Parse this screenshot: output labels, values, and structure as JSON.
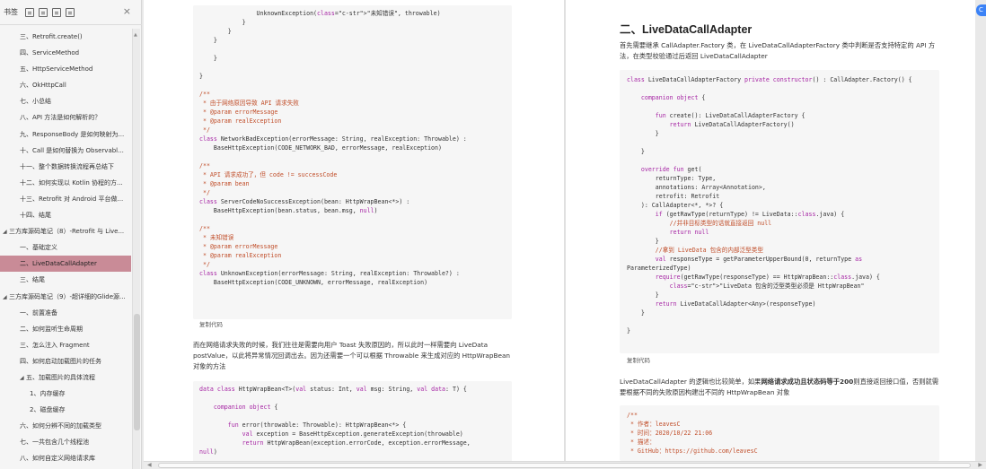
{
  "sidebar": {
    "title": "书签",
    "toolbar_icons": [
      "expand-icon",
      "collapse-icon",
      "bookmark-add-icon",
      "bookmark-icon"
    ],
    "close_label": "×",
    "items": [
      {
        "label": "三、Retrofit.create()",
        "level": 1
      },
      {
        "label": "四、ServiceMethod",
        "level": 1
      },
      {
        "label": "五、HttpServiceMethod",
        "level": 1
      },
      {
        "label": "六、OkHttpCall",
        "level": 1
      },
      {
        "label": "七、小总结",
        "level": 1
      },
      {
        "label": "八、API 方法是如何解析的？",
        "level": 1
      },
      {
        "label": "九、ResponseBody 是如何映射为...",
        "level": 1
      },
      {
        "label": "十、Call 是如何替换为 Observabl...",
        "level": 1
      },
      {
        "label": "十一、整个数据转换流程再总结下",
        "level": 1
      },
      {
        "label": "十二、如何实现以 Kotlin 协程的方...",
        "level": 1
      },
      {
        "label": "十三、Retrofit 对 Android 平台做...",
        "level": 1
      },
      {
        "label": "十四、结尾",
        "level": 1
      },
      {
        "label": "三方库源码笔记（8）-Retrofit 与 Live...",
        "level": 0
      },
      {
        "label": "一、基础定义",
        "level": 1
      },
      {
        "label": "二、LiveDataCallAdapter",
        "level": 1,
        "active": true
      },
      {
        "label": "三、结尾",
        "level": 1
      },
      {
        "label": "三方库源码笔记（9）-超详细的Glide源...",
        "level": 0
      },
      {
        "label": "一、前置准备",
        "level": 1
      },
      {
        "label": "二、如何监听生命周期",
        "level": 1
      },
      {
        "label": "三、怎么注入 Fragment",
        "level": 1
      },
      {
        "label": "四、如何启动加载图片的任务",
        "level": 1
      },
      {
        "label": "五、加载图片的具体流程",
        "level": 1,
        "expanded": true
      },
      {
        "label": "1、内存缓存",
        "level": 2
      },
      {
        "label": "2、磁盘缓存",
        "level": 2
      },
      {
        "label": "六、如何分辨不同的加载类型",
        "level": 1
      },
      {
        "label": "七、一共包含几个线程池",
        "level": 1
      },
      {
        "label": "八、如何自定义网络请求库",
        "level": 1
      }
    ]
  },
  "left_page": {
    "code1": [
      "                UnknownException(\"未知错误\", throwable)",
      "            }",
      "        }",
      "    }",
      "",
      "    }",
      "",
      "}",
      "",
      "/**",
      " * 由于网络原因导致 API 请求失败",
      " * @param errorMessage",
      " * @param realException",
      " */",
      "class NetworkBadException(errorMessage: String, realException: Throwable) :",
      "    BaseHttpException(CODE_NETWORK_BAD, errorMessage, realException)",
      "",
      "/**",
      " * API 请求成功了，但 code != successCode",
      " * @param bean",
      " */",
      "class ServerCodeNoSuccessException(bean: HttpWrapBean<*>) :",
      "    BaseHttpException(bean.status, bean.msg, null)",
      "",
      "/**",
      " * 未知错误",
      " * @param errorMessage",
      " * @param realException",
      " */",
      "class UnknownException(errorMessage: String, realException: Throwable?) :",
      "    BaseHttpException(CODE_UNKNOWN, errorMessage, realException)"
    ],
    "copy_label1": "复制代码",
    "paragraph": "而在网络请求失败的时候，我们往往是需要向用户 Toast 失败原因的，所以此时一样需要向 LiveData postValue，以此将异常情况回调出去。因为还需要一个可以根据 Throwable 来生成对应的 HttpWrapBean 对象的方法",
    "code2": [
      "data class HttpWrapBean<T>(val status: Int, val msg: String, val data: T) {",
      "",
      "    companion object {",
      "",
      "        fun error(throwable: Throwable): HttpWrapBean<*> {",
      "            val exception = BaseHttpException.generateException(throwable)",
      "            return HttpWrapBean(exception.errorCode, exception.errorMessage,",
      "null)"
    ]
  },
  "right_page": {
    "heading": "二、LiveDataCallAdapter",
    "paragraph1": "首先需要继承 CallAdapter.Factory 类，在 LiveDataCallAdapterFactory 类中判断是否支持特定的 API 方法，在类型校验通过后返回 LiveDataCallAdapter",
    "code1": [
      "class LiveDataCallAdapterFactory private constructor() : CallAdapter.Factory() {",
      "",
      "    companion object {",
      "",
      "        fun create(): LiveDataCallAdapterFactory {",
      "            return LiveDataCallAdapterFactory()",
      "        }",
      "",
      "    }",
      "",
      "    override fun get(",
      "        returnType: Type,",
      "        annotations: Array<Annotation>,",
      "        retrofit: Retrofit",
      "    ): CallAdapter<*, *>? {",
      "        if (getRawType(returnType) != LiveData::class.java) {",
      "            //并非目标类型的话就直接返回 null",
      "            return null",
      "        }",
      "        //拿到 LiveData 包含的内部泛型类型",
      "        val responseType = getParameterUpperBound(0, returnType as",
      "ParameterizedType)",
      "        require(getRawType(responseType) == HttpWrapBean::class.java) {",
      "            \"LiveData 包含的泛型类型必须是 HttpWrapBean\"",
      "        }",
      "        return LiveDataCallAdapter<Any>(responseType)",
      "    }",
      "",
      "}"
    ],
    "copy_label1": "复制代码",
    "paragraph2_pre": "LiveDataCallAdapter 的逻辑也比较简单，如果",
    "paragraph2_bold": "网络请求成功且状态码等于200",
    "paragraph2_post": "则直接返回接口值，否则就需要根据不同的失败原因构建出不同的 HttpWrapBean 对象",
    "code2": [
      "/**",
      " * 作者：leavesC",
      " * 时间：2020/10/22 21:06",
      " * 描述：",
      " * GitHub：https://github.com/leavesC"
    ]
  },
  "avatar_label": "C"
}
